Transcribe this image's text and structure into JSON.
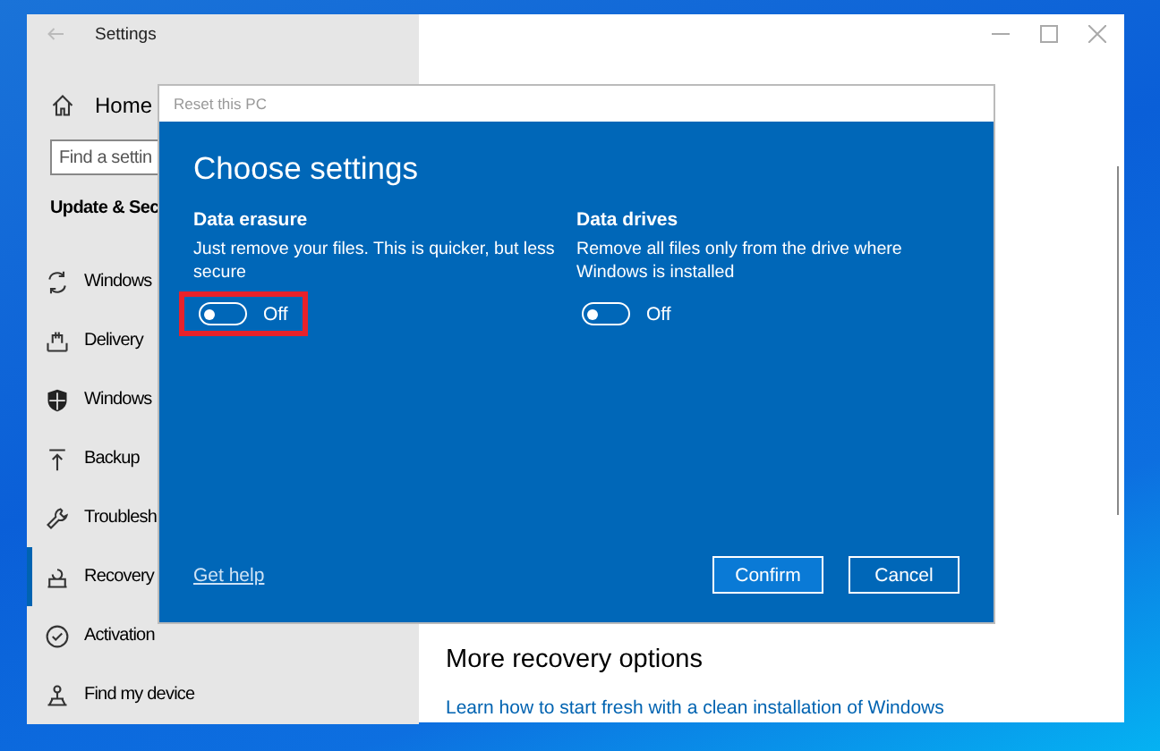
{
  "window": {
    "title": "Settings"
  },
  "sidebar": {
    "home": "Home",
    "search": {
      "placeholder": "Find a settin"
    },
    "section": "Update & Sec",
    "items": [
      {
        "label": "Windows",
        "selected": false
      },
      {
        "label": "Delivery",
        "selected": false
      },
      {
        "label": "Windows",
        "selected": false
      },
      {
        "label": "Backup",
        "selected": false
      },
      {
        "label": "Troublesh",
        "selected": false
      },
      {
        "label": "Recovery",
        "selected": true
      },
      {
        "label": "Activation",
        "selected": false
      },
      {
        "label": "Find my device",
        "selected": false
      }
    ]
  },
  "content": {
    "heading": "More recovery options",
    "link": "Learn how to start fresh with a clean installation of Windows"
  },
  "dialog": {
    "title": "Reset this PC",
    "heading": "Choose settings",
    "options": [
      {
        "label": "Data erasure",
        "description": "Just remove your files. This is quicker, but less secure",
        "on": false,
        "state_text": "Off",
        "highlighted": true
      },
      {
        "label": "Data drives",
        "description": "Remove all files only from the drive where Windows is installed",
        "on": false,
        "state_text": "Off",
        "highlighted": false
      }
    ],
    "help_link": "Get help",
    "buttons": [
      {
        "label": "Confirm",
        "default": true
      },
      {
        "label": "Cancel",
        "default": false
      }
    ]
  }
}
